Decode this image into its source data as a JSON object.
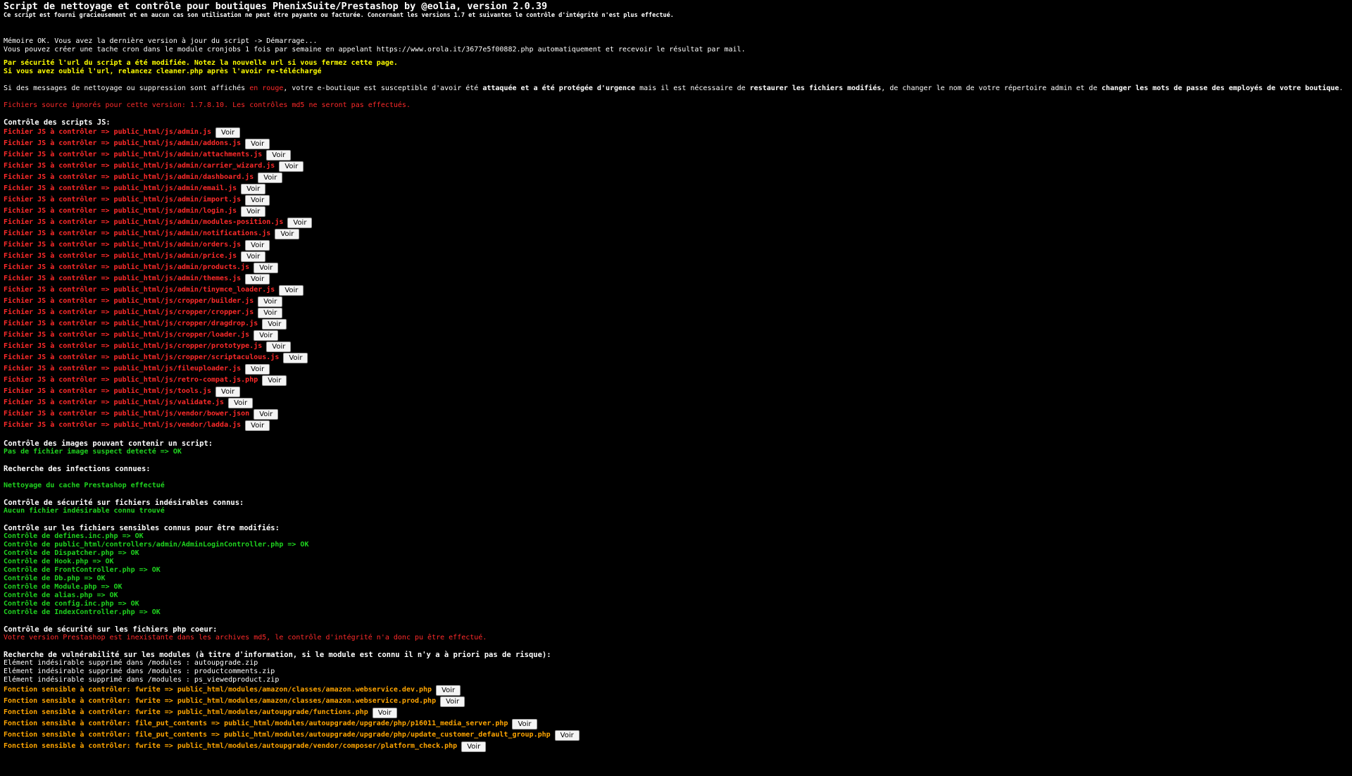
{
  "header": {
    "title": "Script de nettoyage et contrôle pour boutiques PhenixSuite/Prestashop by @eolia, version 2.0.39",
    "subtitle": "Ce script est fourni gracieusement et en aucun cas son utilisation ne peut être payante ou facturée. Concernant les versions 1.7 et suivantes le contrôle d'intégrité n'est plus effectué."
  },
  "intro": {
    "memory_line": "Mémoire OK. Vous avez la dernière version à jour du script -> Démarrage...",
    "cron_line": "Vous pouvez créer une tache cron dans le module cronjobs 1 fois par semaine en appelant https://www.orola.it/3677e5f00882.php automatiquement et recevoir le résultat par mail.",
    "security_line_1": "Par sécurité l'url du script a été modifiée. Notez la nouvelle url si vous fermez cette page.",
    "security_line_2": "Si vous avez oublié l'url, relancez cleaner.php après l'avoir re-téléchargé"
  },
  "warning": {
    "part1": "Si des messages de nettoyage ou suppression sont affichés ",
    "red_word": "en rouge",
    "part2": ", votre e-boutique est susceptible d'avoir été ",
    "bold1": "attaquée et a été protégée d'urgence",
    "part3": " mais il est nécessaire de ",
    "bold2": "restaurer les fichiers modifiés",
    "part4": ", de changer le nom de votre répertoire admin et de ",
    "bold3": "changer les mots de passe des employés de votre boutique",
    "part5": "."
  },
  "ignored_line": "Fichiers source ignorés pour cette version: 1.7.8.10. Les contrôles md5 ne seront pas effectués.",
  "voir_label": "Voir",
  "js_section": {
    "title": "Contrôle des scripts JS:",
    "prefix": "Fichier JS à contrôler => ",
    "files": [
      "public_html/js/admin.js",
      "public_html/js/admin/addons.js",
      "public_html/js/admin/attachments.js",
      "public_html/js/admin/carrier_wizard.js",
      "public_html/js/admin/dashboard.js",
      "public_html/js/admin/email.js",
      "public_html/js/admin/import.js",
      "public_html/js/admin/login.js",
      "public_html/js/admin/modules-position.js",
      "public_html/js/admin/notifications.js",
      "public_html/js/admin/orders.js",
      "public_html/js/admin/price.js",
      "public_html/js/admin/products.js",
      "public_html/js/admin/themes.js",
      "public_html/js/admin/tinymce_loader.js",
      "public_html/js/cropper/builder.js",
      "public_html/js/cropper/cropper.js",
      "public_html/js/cropper/dragdrop.js",
      "public_html/js/cropper/loader.js",
      "public_html/js/cropper/prototype.js",
      "public_html/js/cropper/scriptaculous.js",
      "public_html/js/fileuploader.js",
      "public_html/js/retro-compat.js.php",
      "public_html/js/tools.js",
      "public_html/js/validate.js",
      "public_html/js/vendor/bower.json",
      "public_html/js/vendor/ladda.js"
    ]
  },
  "images_section": {
    "title": "Contrôle des images pouvant contenir un script:",
    "result": "Pas de fichier image suspect detecté => OK"
  },
  "infections_section": {
    "title": "Recherche des infections connues:",
    "result": "Nettoyage du cache Prestashop effectué"
  },
  "undesirable_section": {
    "title": "Contrôle de sécurité sur fichiers indésirables connus:",
    "result": "Aucun fichier indésirable connu trouvé"
  },
  "sensitive_section": {
    "title": "Contrôle sur les fichiers sensibles connus pour être modifiés:",
    "items": [
      "Contrôle de defines.inc.php => OK",
      "Contrôle de public_html/controllers/admin/AdminLoginController.php => OK",
      "Contrôle de Dispatcher.php => OK",
      "Contrôle de Hook.php => OK",
      "Contrôle de FrontController.php => OK",
      "Contrôle de Db.php => OK",
      "Contrôle de Module.php => OK",
      "Contrôle de alias.php => OK",
      "Contrôle de config.inc.php => OK",
      "Contrôle de IndexController.php => OK"
    ]
  },
  "core_section": {
    "title": "Contrôle de sécurité sur les fichiers php coeur:",
    "result": "Votre version Prestashop est inexistante dans les archives md5, le contrôle d'intégrité n'a donc pu être effectué."
  },
  "modules_section": {
    "title": "Recherche de vulnérabilité sur les modules (à titre d'information, si le module est connu il n'y a à priori pas de risque):",
    "removed": [
      "Elément indésirable supprimé dans /modules : autoupgrade.zip",
      "Elément indésirable supprimé dans /modules : productcomments.zip",
      "Elément indésirable supprimé dans /modules : ps_viewedproduct.zip"
    ],
    "functions": [
      "Fonction sensible à contrôler: fwrite => public_html/modules/amazon/classes/amazon.webservice.dev.php",
      "Fonction sensible à contrôler: fwrite => public_html/modules/amazon/classes/amazon.webservice.prod.php",
      "Fonction sensible à contrôler: fwrite => public_html/modules/autoupgrade/functions.php",
      "Fonction sensible à contrôler: file_put_contents => public_html/modules/autoupgrade/upgrade/php/p16011_media_server.php",
      "Fonction sensible à contrôler: file_put_contents => public_html/modules/autoupgrade/upgrade/php/update_customer_default_group.php",
      "Fonction sensible à contrôler: fwrite => public_html/modules/autoupgrade/vendor/composer/platform_check.php"
    ]
  }
}
